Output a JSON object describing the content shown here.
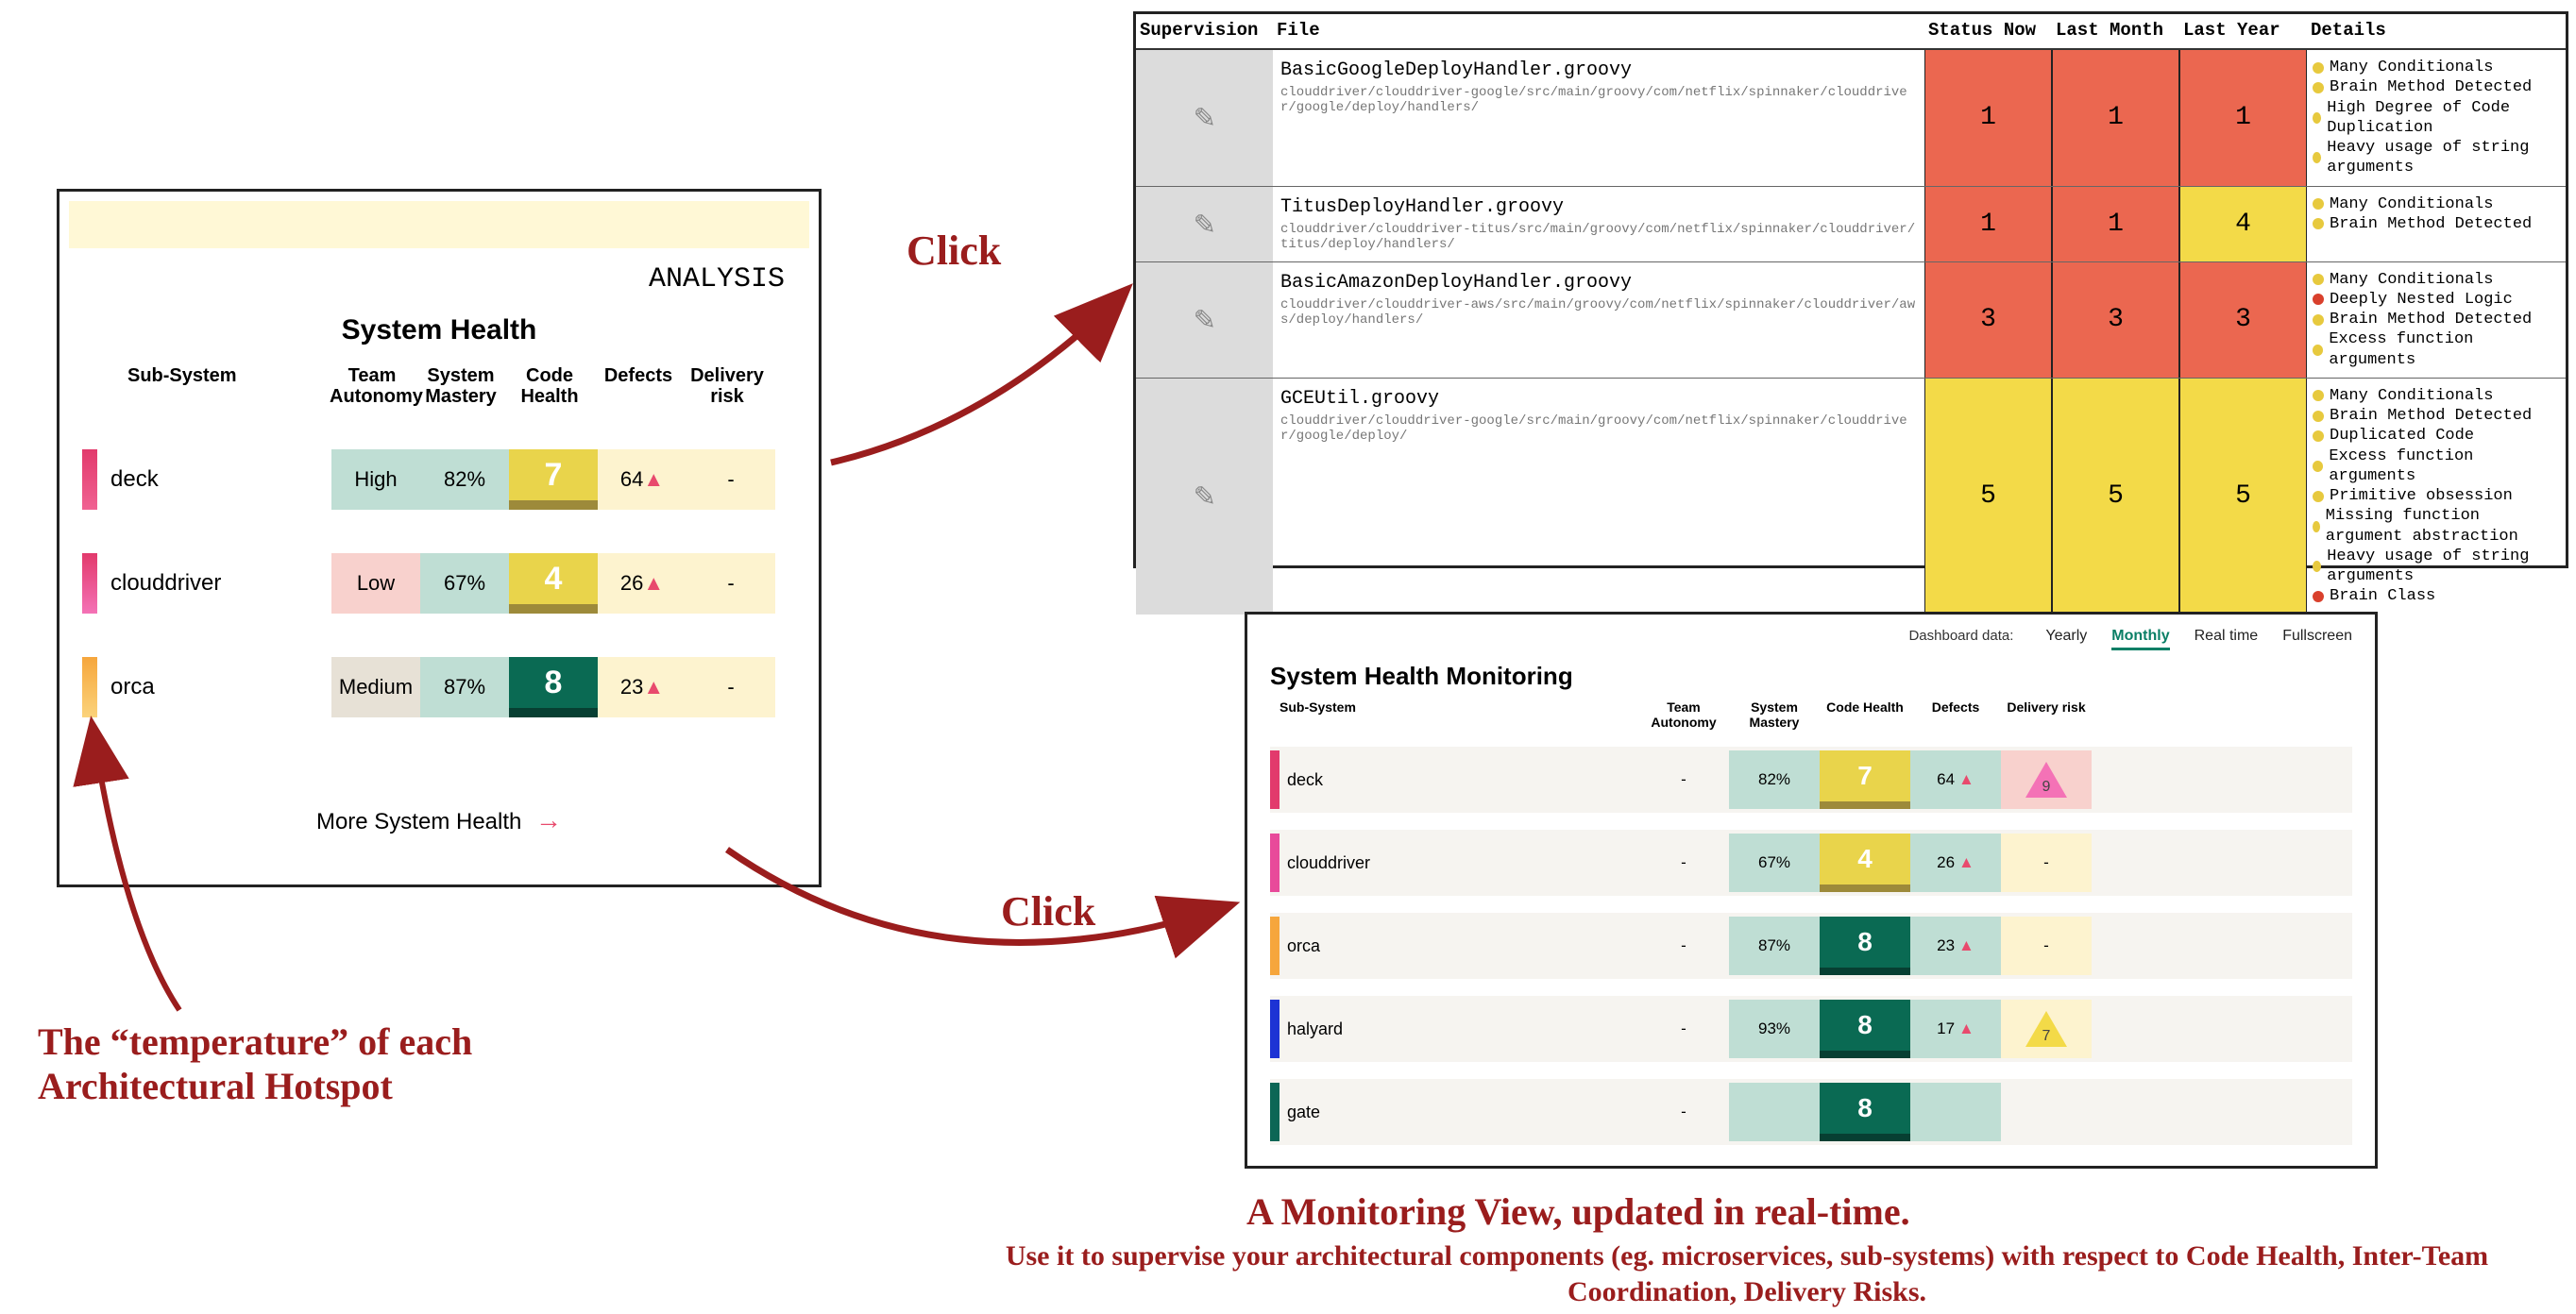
{
  "left_panel": {
    "top_label": "ANALYSIS",
    "title": "System Health",
    "headers": [
      "Sub-System",
      "Team Autonomy",
      "System Mastery",
      "Code Health",
      "Defects",
      "Delivery risk"
    ],
    "rows": [
      {
        "hot": "pink",
        "name": "deck",
        "autonomy": "High",
        "mastery": "82%",
        "code": "7",
        "defects": "64",
        "risk": "-"
      },
      {
        "hot": "mag",
        "name": "clouddriver",
        "autonomy": "Low",
        "mastery": "67%",
        "code": "4",
        "defects": "26",
        "risk": "-"
      },
      {
        "hot": "orange",
        "name": "orca",
        "autonomy": "Medium",
        "mastery": "87%",
        "code": "8",
        "defects": "23",
        "risk": "-"
      }
    ],
    "more": "More System Health"
  },
  "annotations": {
    "click1": "Click",
    "click2": "Click",
    "hotspot_caption": "The “temperature” of each Architectural Hotspot",
    "monitor_title": "A Monitoring View, updated in real-time.",
    "monitor_sub": "Use it to supervise your architectural components (eg. microservices, sub-systems) with respect to Code Health, Inter-Team Coordination, Delivery Risks."
  },
  "file_table": {
    "headers": [
      "Supervision",
      "File",
      "Status Now",
      "Last Month",
      "Last Year",
      "Details"
    ],
    "rows": [
      {
        "file": "BasicGoogleDeployHandler.groovy",
        "path": "clouddriver/clouddriver-google/src/main/groovy/com/netflix/spinnaker/clouddriver/google/deploy/handlers/",
        "now": "1",
        "month": "1",
        "year": "1",
        "nowC": "red",
        "monthC": "red",
        "yearC": "red",
        "details": [
          [
            "y",
            "Many Conditionals"
          ],
          [
            "y",
            "Brain Method Detected"
          ],
          [
            "y",
            "High Degree of Code Duplication"
          ],
          [
            "y",
            "Heavy usage of string arguments"
          ]
        ]
      },
      {
        "file": "TitusDeployHandler.groovy",
        "path": "clouddriver/clouddriver-titus/src/main/groovy/com/netflix/spinnaker/clouddriver/titus/deploy/handlers/",
        "now": "1",
        "month": "1",
        "year": "4",
        "nowC": "red",
        "monthC": "red",
        "yearC": "yellow",
        "details": [
          [
            "y",
            "Many Conditionals"
          ],
          [
            "y",
            "Brain Method Detected"
          ]
        ]
      },
      {
        "file": "BasicAmazonDeployHandler.groovy",
        "path": "clouddriver/clouddriver-aws/src/main/groovy/com/netflix/spinnaker/clouddriver/aws/deploy/handlers/",
        "now": "3",
        "month": "3",
        "year": "3",
        "nowC": "red",
        "monthC": "red",
        "yearC": "red",
        "details": [
          [
            "y",
            "Many Conditionals"
          ],
          [
            "r",
            "Deeply Nested Logic"
          ],
          [
            "y",
            "Brain Method Detected"
          ],
          [
            "y",
            "Excess function arguments"
          ]
        ]
      },
      {
        "file": "GCEUtil.groovy",
        "path": "clouddriver/clouddriver-google/src/main/groovy/com/netflix/spinnaker/clouddriver/google/deploy/",
        "now": "5",
        "month": "5",
        "year": "5",
        "nowC": "yellow",
        "monthC": "yellow",
        "yearC": "yellow",
        "details": [
          [
            "y",
            "Many Conditionals"
          ],
          [
            "y",
            "Brain Method Detected"
          ],
          [
            "y",
            "Duplicated Code"
          ],
          [
            "y",
            "Excess function arguments"
          ],
          [
            "y",
            "Primitive obsession"
          ],
          [
            "y",
            "Missing function argument abstraction"
          ],
          [
            "y",
            "Heavy usage of string arguments"
          ],
          [
            "r",
            "Brain Class"
          ]
        ]
      }
    ]
  },
  "monitor": {
    "data_label": "Dashboard data:",
    "tabs": [
      "Yearly",
      "Monthly",
      "Real time",
      "Fullscreen"
    ],
    "active_tab": "Monthly",
    "title": "System Health Monitoring",
    "headers": [
      "Sub-System",
      "Team Autonomy",
      "System Mastery",
      "Code Health",
      "Defects",
      "Delivery risk"
    ],
    "rows": [
      {
        "hot": "pink",
        "name": "deck",
        "autonomy": "-",
        "mastery": "82%",
        "code": "7",
        "codec": "code7",
        "defects": "64",
        "risk": "9",
        "riskC": "risk9"
      },
      {
        "hot": "mag",
        "name": "clouddriver",
        "autonomy": "-",
        "mastery": "67%",
        "code": "4",
        "codec": "code4",
        "defects": "26",
        "risk": "-",
        "riskC": "dash"
      },
      {
        "hot": "orange",
        "name": "orca",
        "autonomy": "-",
        "mastery": "87%",
        "code": "8",
        "codec": "code8",
        "defects": "23",
        "risk": "-",
        "riskC": "dash"
      },
      {
        "hot": "blue",
        "name": "halyard",
        "autonomy": "-",
        "mastery": "93%",
        "code": "8",
        "codec": "code8",
        "defects": "17",
        "risk": "7",
        "riskC": "risk7"
      },
      {
        "hot": "teal",
        "name": "gate",
        "autonomy": "-",
        "mastery": "",
        "code": "8",
        "codec": "code8",
        "defects": "",
        "risk": "",
        "riskC": ""
      }
    ]
  }
}
